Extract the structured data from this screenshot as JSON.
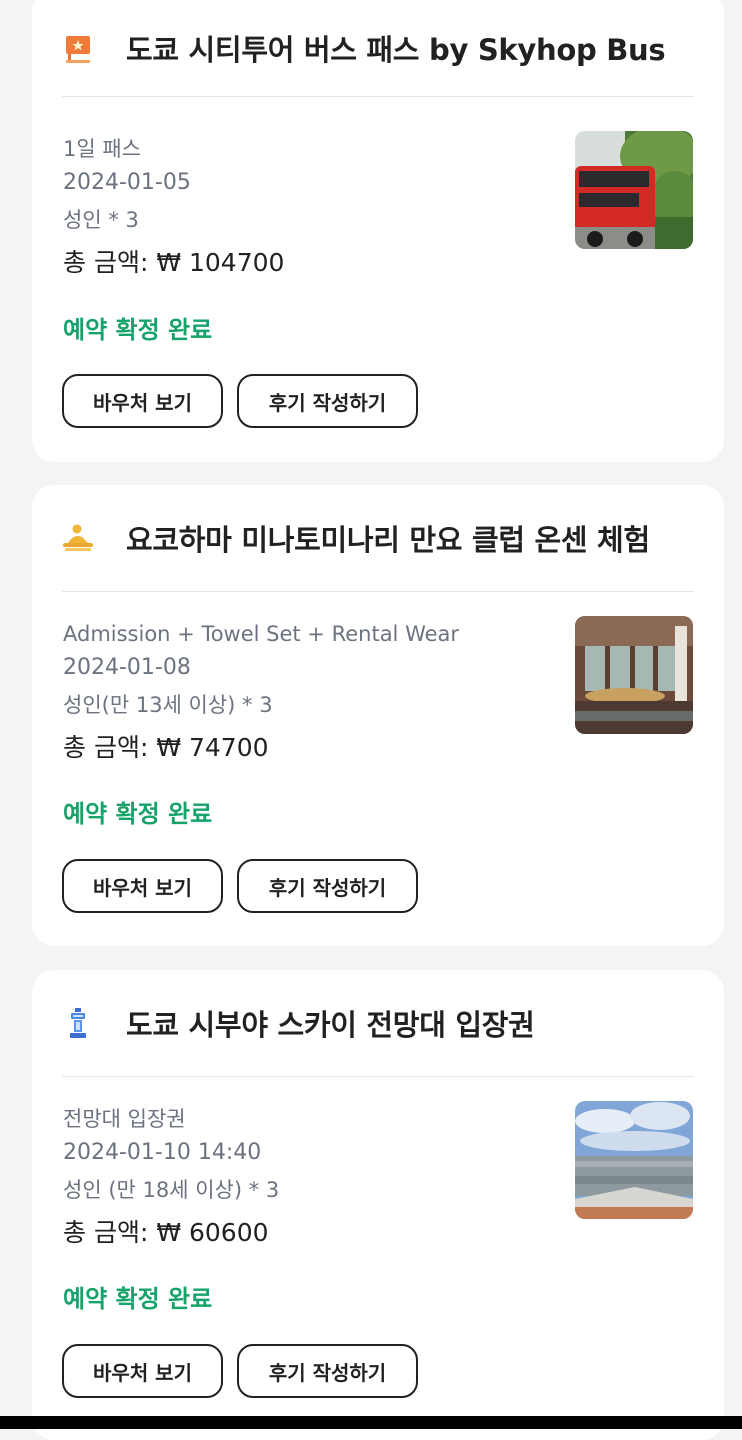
{
  "bookings": [
    {
      "title": "도쿄 시티투어 버스 패스 by Skyhop Bus",
      "icon": "flag-icon",
      "option": "1일 패스",
      "date": "2024-01-05",
      "quantity": "성인 * 3",
      "total": "총 금액: ₩ 104700",
      "status": "예약 확정 완료",
      "voucher_label": "바우처 보기",
      "review_label": "후기 작성하기",
      "thumbnail": "bus-photo"
    },
    {
      "title": "요코하마 미나토미나리 만요 클럽 온센 체험",
      "icon": "spa-person-icon",
      "option": "Admission + Towel Set + Rental Wear",
      "date": "2024-01-08",
      "quantity": " 성인(만 13세 이상) * 3",
      "total": "총 금액: ₩ 74700",
      "status": "예약 확정 완료",
      "voucher_label": "바우처 보기",
      "review_label": "후기 작성하기",
      "thumbnail": "onsen-photo"
    },
    {
      "title": "도쿄 시부야 스카이 전망대 입장권",
      "icon": "tower-icon",
      "option": "전망대 입장권",
      "date": "2024-01-10 14:40",
      "quantity": " 성인 (만 18세 이상) * 3",
      "total": "총 금액: ₩ 60600",
      "status": "예약 확정 완료",
      "voucher_label": "바우처 보기",
      "review_label": "후기 작성하기",
      "thumbnail": "city-view-photo"
    }
  ],
  "colors": {
    "status_green": "#16a36a",
    "text_dark": "#1f2123",
    "text_gray": "#6b7280"
  }
}
